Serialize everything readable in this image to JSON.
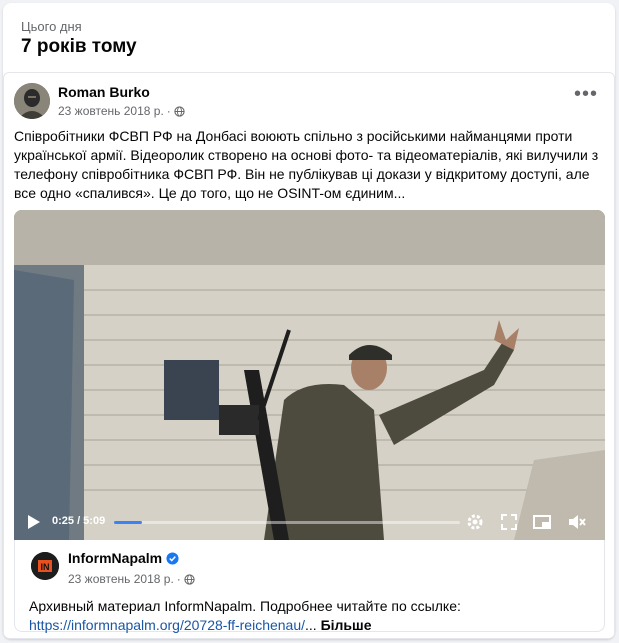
{
  "memory": {
    "label": "Цього дня",
    "title": "7 років тому"
  },
  "post": {
    "author": "Roman Burko",
    "date": "23 жовтень 2018 р.",
    "dot": "·",
    "more_icon": "•••",
    "text": "Співробітники ФСВП РФ на Донбасі воюють спільно з російськими найманцями проти української армії. Відеоролик створено на основі фото- та відеоматеріалів, які вилучили з телефону співробітника ФСВП РФ. Він не публікував ці докази у відкритому доступі, але все одно «спалився». Це до того, що не OSINT-ом єдиним..."
  },
  "video": {
    "time": "0:25 / 5:09",
    "progress_fraction": 0.08,
    "icons": [
      "play-icon",
      "settings-icon",
      "fullscreen-icon",
      "pip-icon",
      "volume-muted-icon"
    ]
  },
  "shared": {
    "page_name": "InformNapalm",
    "date": "23 жовтень 2018 р.",
    "dot": "·",
    "text": "Архивный материал InformNapalm. Подробнее читайте по ссылке:",
    "link": "https://informnapalm.org/20728-ff-reichenau/",
    "ellipsis": "...",
    "more_label": "Більше"
  },
  "colors": {
    "accent": "#1877f2",
    "link": "#1a56a6",
    "progress": "#3b82f6"
  }
}
